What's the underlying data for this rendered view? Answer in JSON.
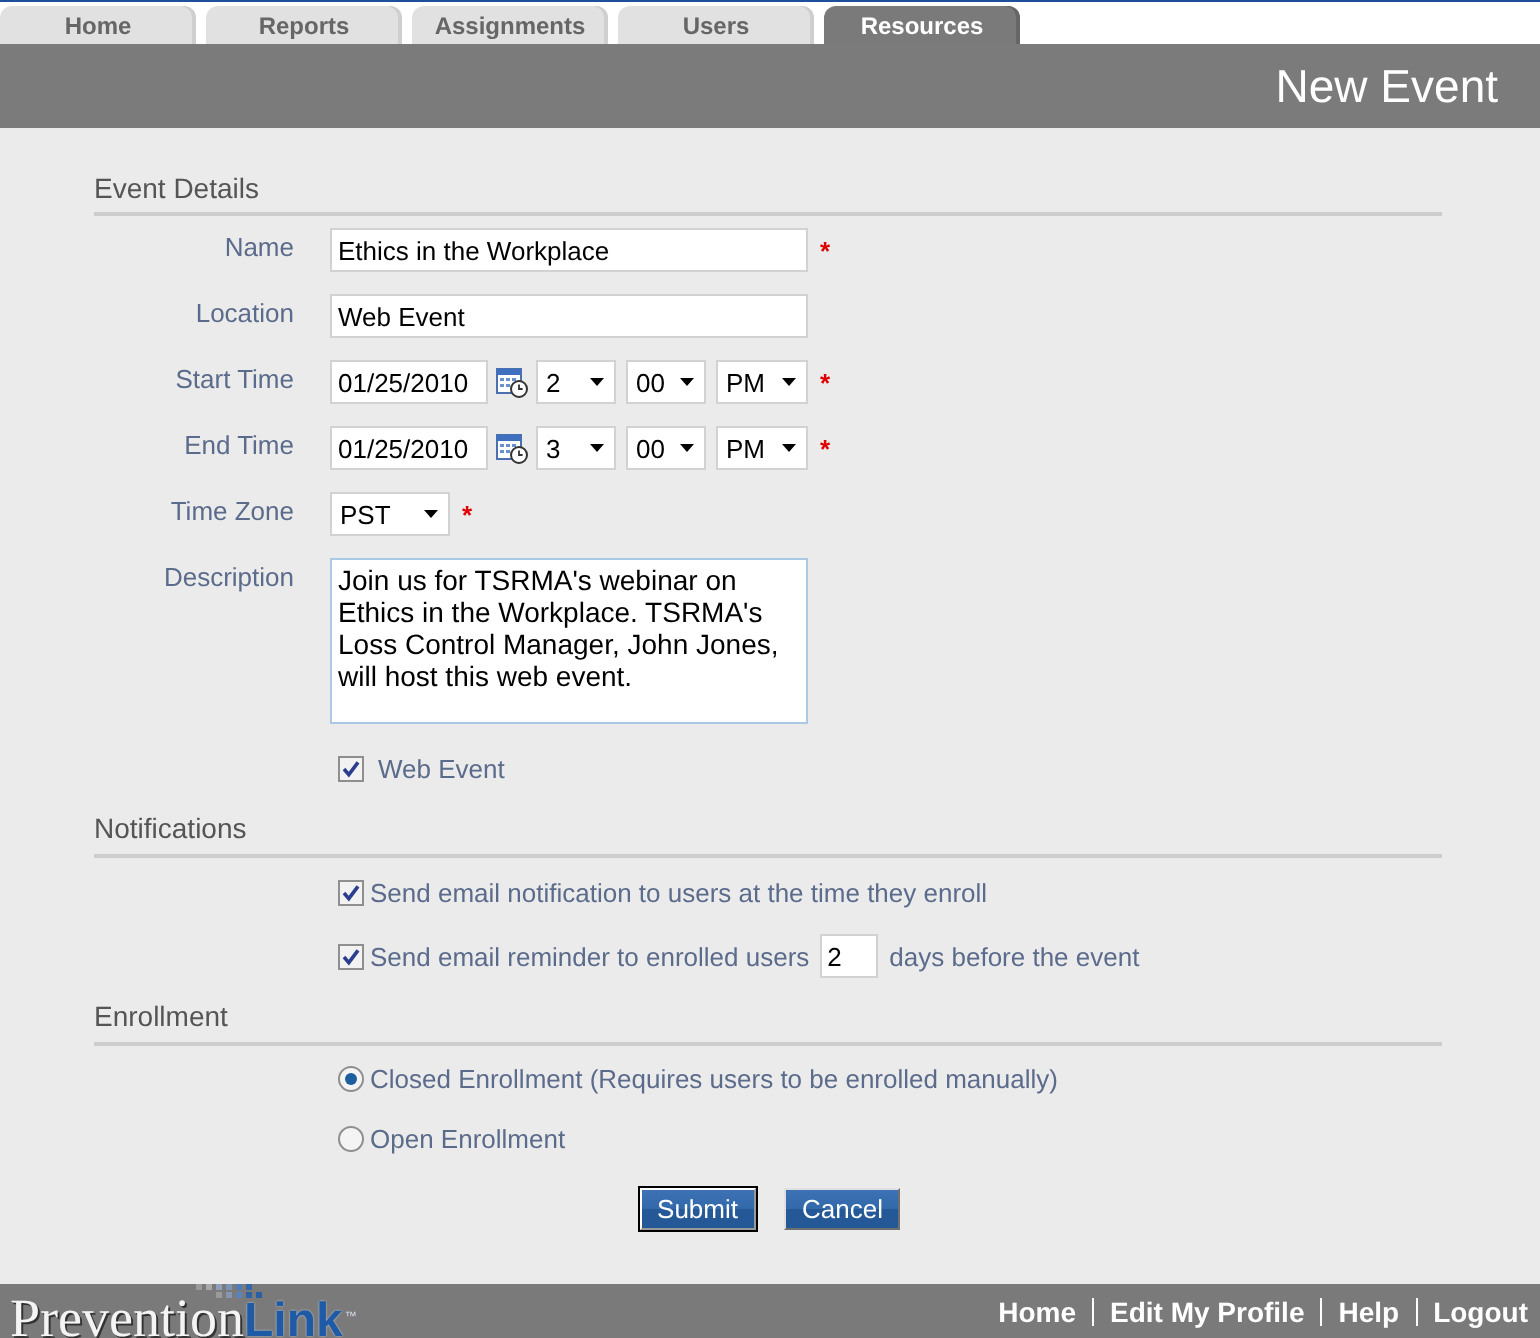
{
  "tabs": [
    {
      "label": "Home",
      "selected": false
    },
    {
      "label": "Reports",
      "selected": false
    },
    {
      "label": "Assignments",
      "selected": false
    },
    {
      "label": "Users",
      "selected": false
    },
    {
      "label": "Resources",
      "selected": true
    }
  ],
  "header": {
    "title": "New Event"
  },
  "event_details": {
    "heading": "Event Details",
    "fields": [
      {
        "kind": "text",
        "label": "Name",
        "value": "Ethics in the Workplace",
        "required_mark": "*"
      },
      {
        "kind": "text",
        "label": "Location",
        "value": "Web Event"
      },
      {
        "kind": "datetime",
        "label": "Start Time",
        "date": "01/25/2010",
        "hour": "2",
        "minute": "00",
        "period": "PM",
        "required_mark": "*"
      },
      {
        "kind": "datetime",
        "label": "End Time",
        "date": "01/25/2010",
        "hour": "3",
        "minute": "00",
        "period": "PM",
        "required_mark": "*"
      },
      {
        "kind": "select",
        "label": "Time Zone",
        "value": "PST",
        "required_mark": "*"
      },
      {
        "kind": "textarea",
        "label": "Description",
        "value": "Join us for TSRMA's webinar on Ethics in the Workplace. TSRMA's Loss Control Manager, John Jones, will host this web event."
      }
    ],
    "web_event": {
      "label": "Web Event",
      "checked": true
    }
  },
  "notifications": {
    "heading": "Notifications",
    "options": [
      {
        "kind": "checkbox",
        "label": "Send email notification to users at the time they enroll",
        "checked": true
      },
      {
        "kind": "checkbox_with_days",
        "label": "Send email reminder to enrolled users",
        "checked": true,
        "days": "2",
        "suffix": "days before the event"
      }
    ]
  },
  "enrollment": {
    "heading": "Enrollment",
    "options": [
      {
        "label": "Closed Enrollment (Requires users to be enrolled manually)",
        "selected": true
      },
      {
        "label": "Open Enrollment",
        "selected": false
      }
    ]
  },
  "buttons": [
    {
      "label": "Submit",
      "focused": true
    },
    {
      "label": "Cancel",
      "focused": false
    }
  ],
  "footer": {
    "logo": {
      "first": "Prevention",
      "second": "Link",
      "trademark": "™"
    },
    "links": [
      "Home",
      "Edit My Profile",
      "Help",
      "Logout"
    ]
  }
}
